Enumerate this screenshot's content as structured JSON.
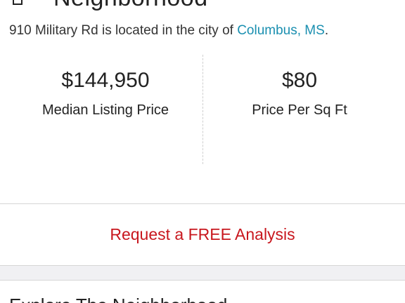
{
  "section": {
    "icon": "home-icon",
    "title": "Neighborhood"
  },
  "location": {
    "prefix": "910 Military Rd is located in the city of ",
    "city_link": "Columbus, MS",
    "suffix": "."
  },
  "stats": [
    {
      "value": "$144,950",
      "label": "Median Listing Price"
    },
    {
      "value": "$80",
      "label": "Price Per Sq Ft"
    }
  ],
  "cta": {
    "label": "Request a FREE Analysis",
    "color": "#c8171e"
  },
  "next_section": {
    "title": "Explore The Neighborhood"
  },
  "colors": {
    "link": "#1a8fb0",
    "divider": "#d6d6d6",
    "band": "#f0f0f3"
  }
}
